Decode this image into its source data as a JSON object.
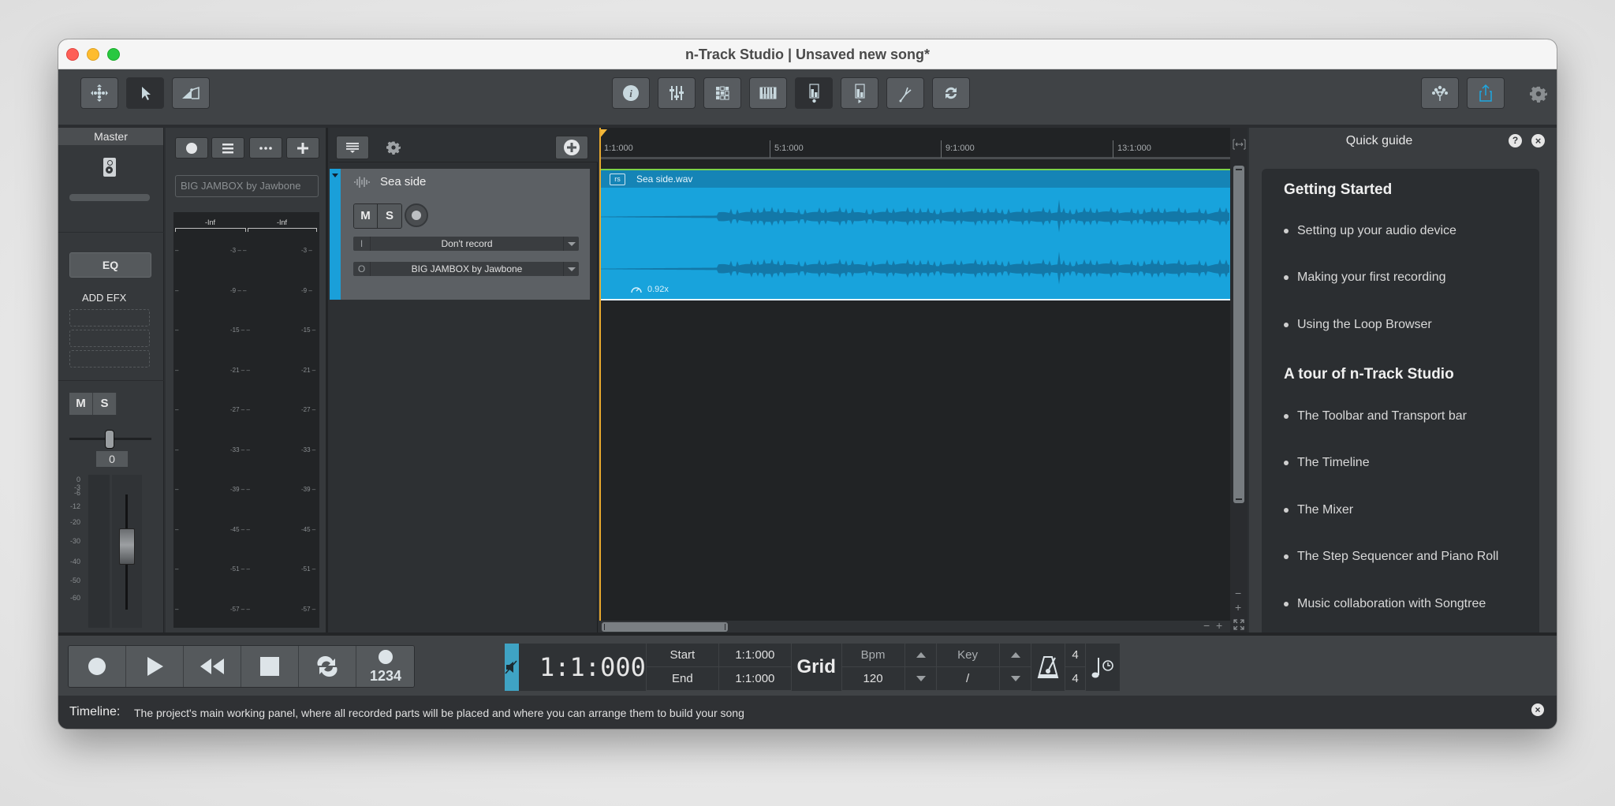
{
  "window": {
    "title": "n-Track Studio | Unsaved new song*"
  },
  "toolbar": {
    "left_tools": [
      {
        "icon": "move-icon",
        "active": false
      },
      {
        "icon": "pointer-icon",
        "active": true
      },
      {
        "icon": "volume-envelope-icon",
        "active": false
      }
    ],
    "center_tools": [
      {
        "icon": "info-icon",
        "active": false
      },
      {
        "icon": "mixer-icon",
        "active": false
      },
      {
        "icon": "step-sequencer-icon",
        "active": false
      },
      {
        "icon": "piano-icon",
        "active": false
      },
      {
        "icon": "record-meter-icon",
        "active": true
      },
      {
        "icon": "playback-meter-icon",
        "active": false
      },
      {
        "icon": "tuner-icon",
        "active": false
      },
      {
        "icon": "sync-icon",
        "active": false
      }
    ],
    "right_tools": [
      {
        "icon": "songtree-icon"
      },
      {
        "icon": "share-icon",
        "color": "#1ea7e0"
      }
    ]
  },
  "master": {
    "label": "Master",
    "eq_label": "EQ",
    "add_efx_label": "ADD EFX",
    "mute_label": "M",
    "solo_label": "S",
    "pan_value": "0",
    "db_scale": [
      "0",
      "-3",
      "-6",
      "-12",
      "-20",
      "-30",
      "-40",
      "-50",
      "-60"
    ]
  },
  "input_panel": {
    "device": "BIG JAMBOX by Jawbone",
    "meter_left_label": "-Inf",
    "meter_right_label": "-Inf",
    "ticks": [
      "-3",
      "-9",
      "-15",
      "-21",
      "-27",
      "-33",
      "-39",
      "-45",
      "-51",
      "-57"
    ]
  },
  "track": {
    "name": "Sea side",
    "mute_label": "M",
    "solo_label": "S",
    "input_prefix": "I",
    "input_value": "Don't record",
    "output_prefix": "O",
    "output_value": "BIG JAMBOX by Jawbone",
    "color": "#1a9fd9"
  },
  "timeline": {
    "ruler": [
      "1:1:000",
      "5:1:000",
      "9:1:000",
      "13:1:000"
    ],
    "clip": {
      "badge": "rs",
      "name": "Sea side.wav",
      "speed": "0.92x"
    },
    "zoom_minus": "−",
    "zoom_plus": "+"
  },
  "quick_guide": {
    "title": "Quick guide",
    "help": "?",
    "close": "×",
    "sections": [
      {
        "heading": "Getting Started",
        "items": [
          "Setting up your audio device",
          "Making your first recording",
          "Using the Loop Browser"
        ]
      },
      {
        "heading": "A tour of n-Track Studio",
        "items": [
          "The Toolbar and Transport bar",
          "The Timeline",
          "The Mixer",
          "The Step Sequencer and Piano Roll",
          "Music collaboration with Songtree"
        ]
      }
    ]
  },
  "transport": {
    "count_in_label": "1234",
    "time": "1:1:000",
    "start_label": "Start",
    "start_value": "1:1:000",
    "end_label": "End",
    "end_value": "1:1:000",
    "grid_label": "Grid",
    "bpm_label": "Bpm",
    "bpm_value": "120",
    "key_label": "Key",
    "key_value": "/",
    "sig_top": "4",
    "sig_bottom": "4"
  },
  "status": {
    "key": "Timeline:",
    "text": "The project's main working panel, where all recorded parts will be placed and where you can arrange them to build your song",
    "close": "×"
  }
}
